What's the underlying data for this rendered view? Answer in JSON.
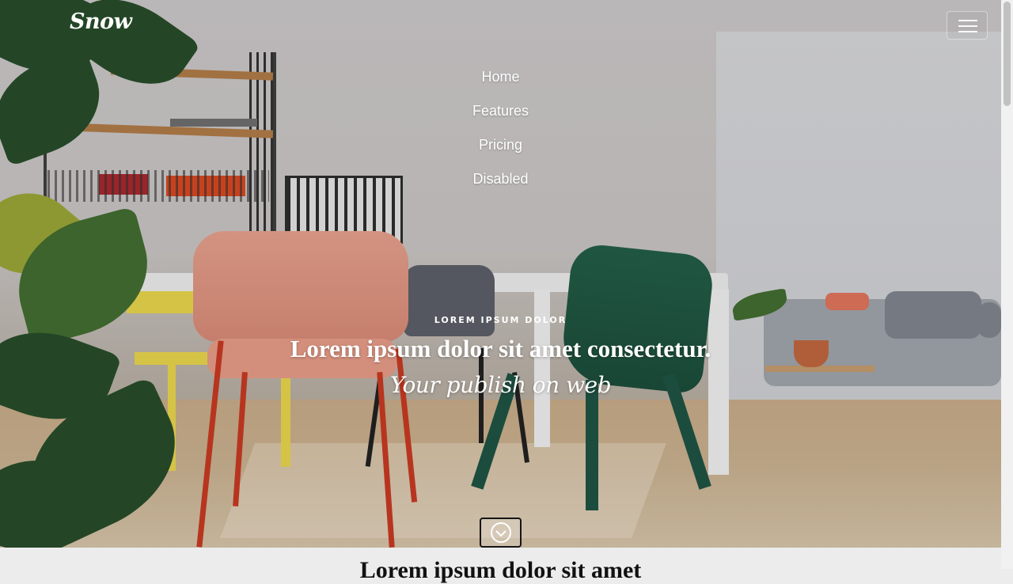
{
  "navbar": {
    "brand": "Snow",
    "toggler_icon": "hamburger-menu-icon",
    "items": [
      {
        "label": "Home"
      },
      {
        "label": "Features"
      },
      {
        "label": "Pricing"
      },
      {
        "label": "Disabled"
      }
    ]
  },
  "hero": {
    "eyebrow": "Lorem Ipsum Dolor",
    "headline": "Lorem ipsum dolor sit amet consectetur.",
    "tagline": "Your publish on web",
    "scroll_button_icon": "chevron-down-circle-icon"
  },
  "section": {
    "title": "Lorem ipsum dolor sit amet"
  },
  "colors": {
    "text_on_hero": "#ffffff",
    "page_background": "#ececec"
  }
}
